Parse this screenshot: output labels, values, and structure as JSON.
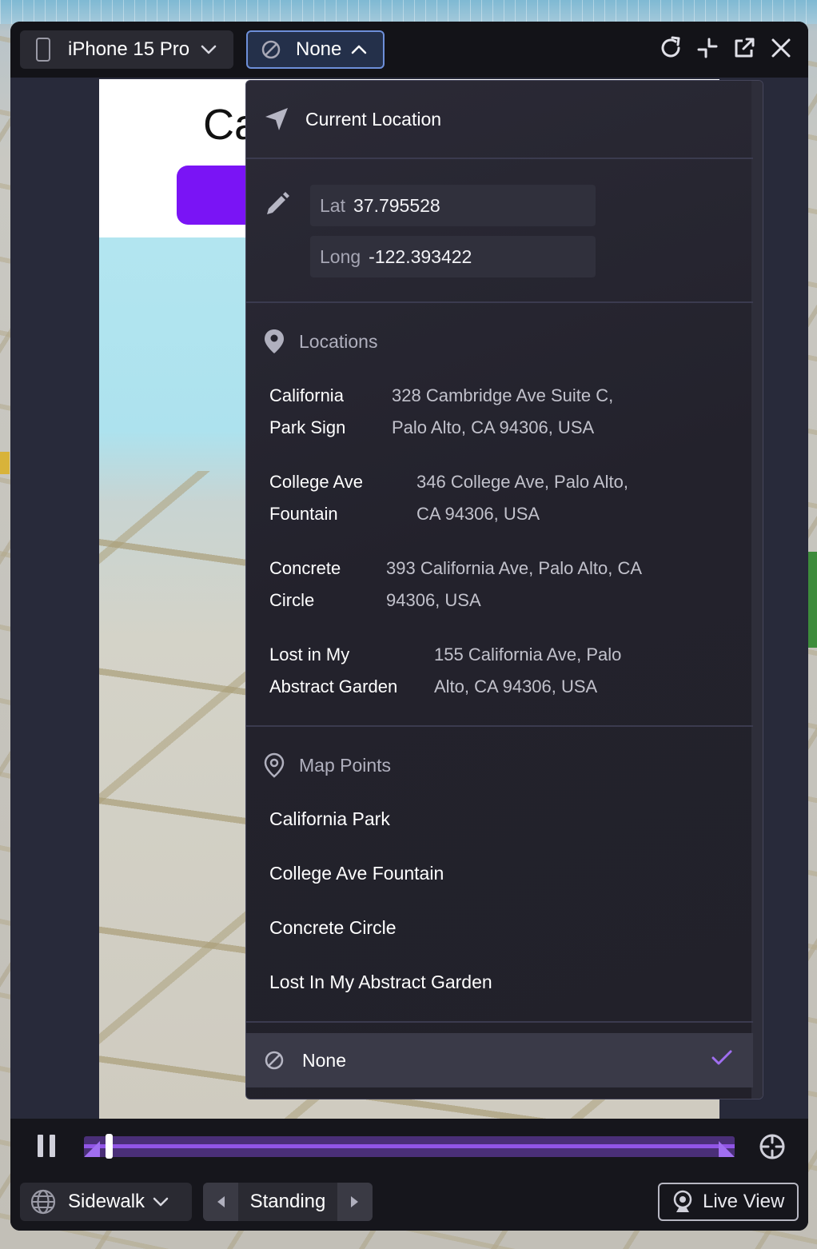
{
  "toolbar": {
    "device_label": "iPhone 15 Pro",
    "location_label": "None"
  },
  "app_screen": {
    "title_fragment": "Ca"
  },
  "dropdown": {
    "current_location_label": "Current Location",
    "coords": {
      "lat_label": "Lat",
      "lat_value": "37.795528",
      "long_label": "Long",
      "long_value": "-122.393422"
    },
    "locations_header": "Locations",
    "locations": [
      {
        "name_line1": "California",
        "name_line2": "Park Sign",
        "addr_line1": "328 Cambridge Ave Suite C,",
        "addr_line2": "Palo Alto, CA 94306, USA"
      },
      {
        "name_line1": "College Ave",
        "name_line2": "Fountain",
        "addr_line1": "346 College Ave, Palo Alto,",
        "addr_line2": "CA 94306, USA"
      },
      {
        "name_line1": "Concrete",
        "name_line2": "Circle",
        "addr_line1": "393 California Ave, Palo Alto, CA",
        "addr_line2": "94306, USA"
      },
      {
        "name_line1": "Lost in My",
        "name_line2": "Abstract Garden",
        "addr_line1": "155 California Ave, Palo",
        "addr_line2": "Alto, CA 94306, USA"
      }
    ],
    "map_points_header": "Map Points",
    "map_points": [
      "California Park",
      "College Ave Fountain",
      "Concrete Circle",
      "Lost In My Abstract Garden"
    ],
    "none_label": "None"
  },
  "playback": {
    "progress_fraction": 0.02
  },
  "bottom": {
    "mode_label": "Sidewalk",
    "stance_label": "Standing",
    "live_view_label": "Live View"
  },
  "colors": {
    "accent": "#9155e6",
    "check": "#a06ef0",
    "app_button": "#7a14f5",
    "selected_border": "#6d8fd9"
  },
  "icons": {
    "device": "phone-icon",
    "none": "prohibited-icon",
    "reload": "reload-icon",
    "collapse": "collapse-icon",
    "popout": "popout-icon",
    "close": "close-icon",
    "current_location": "navigation-arrow-icon",
    "edit": "pencil-icon",
    "locations": "map-pin-icon",
    "map_points": "map-pin-outline-icon",
    "check": "check-icon",
    "pause": "pause-icon",
    "recenter": "crosshair-icon",
    "globe": "globe-icon",
    "live_view": "webcam-icon"
  }
}
